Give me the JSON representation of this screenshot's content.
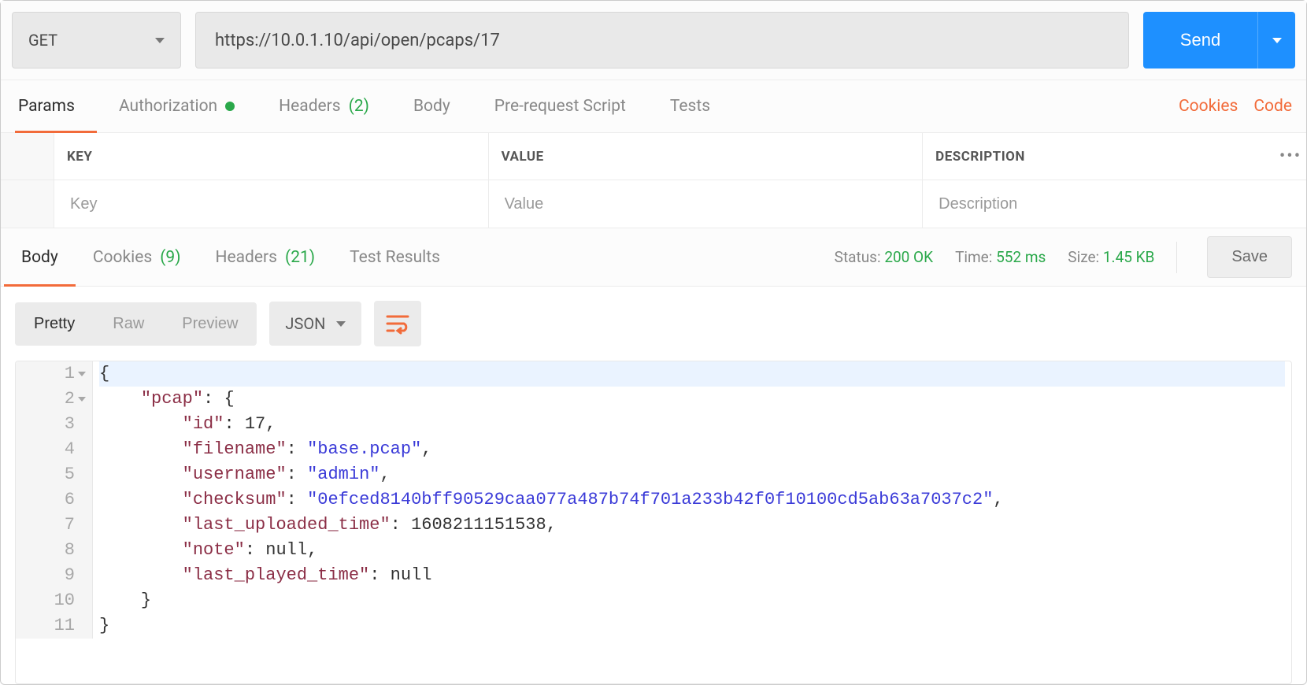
{
  "request": {
    "method": "GET",
    "url": "https://10.0.1.10/api/open/pcaps/17",
    "send_label": "Send"
  },
  "request_tabs": {
    "params": "Params",
    "authorization": "Authorization",
    "headers": "Headers",
    "headers_count": "(2)",
    "body": "Body",
    "prerequest": "Pre-request Script",
    "tests": "Tests",
    "cookies_link": "Cookies",
    "code_link": "Code"
  },
  "kv_headers": {
    "key": "KEY",
    "value": "VALUE",
    "description": "DESCRIPTION"
  },
  "kv_placeholders": {
    "key": "Key",
    "value": "Value",
    "description": "Description"
  },
  "response_tabs": {
    "body": "Body",
    "cookies": "Cookies",
    "cookies_count": "(9)",
    "headers": "Headers",
    "headers_count": "(21)",
    "test_results": "Test Results"
  },
  "response_meta": {
    "status_label": "Status:",
    "status_value": "200 OK",
    "time_label": "Time:",
    "time_value": "552 ms",
    "size_label": "Size:",
    "size_value": "1.45 KB",
    "save_label": "Save"
  },
  "body_controls": {
    "pretty": "Pretty",
    "raw": "Raw",
    "preview": "Preview",
    "format": "JSON"
  },
  "code_lines": [
    "{",
    "    \"pcap\": {",
    "        \"id\": 17,",
    "        \"filename\": \"base.pcap\",",
    "        \"username\": \"admin\",",
    "        \"checksum\": \"0efced8140bff90529caa077a487b74f701a233b42f0f10100cd5ab63a7037c2\",",
    "        \"last_uploaded_time\": 1608211151538,",
    "        \"note\": null,",
    "        \"last_played_time\": null",
    "    }",
    "}"
  ]
}
